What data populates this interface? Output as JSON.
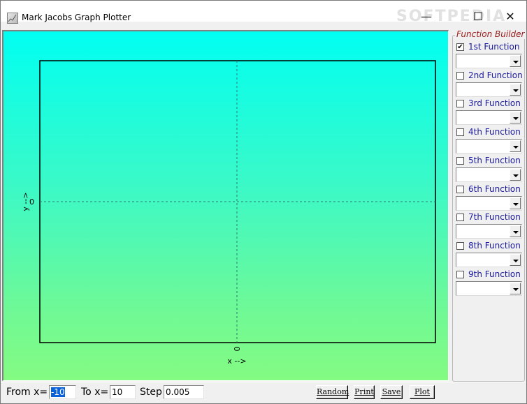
{
  "window": {
    "title": "Mark Jacobs Graph Plotter",
    "controls": {
      "minimize": "—",
      "maximize": "☐",
      "close": "✕"
    },
    "watermark": "SOFTPEDIA"
  },
  "plot": {
    "y_axis_label": "y -->",
    "x_axis_label": "x -->",
    "y_zero_label": "0",
    "x_zero_label": "0",
    "gradient_colors": [
      "#00fff2",
      "#84fb82"
    ]
  },
  "function_builder": {
    "title": "Function Builder",
    "functions": [
      {
        "label": "1st Function",
        "checked": true,
        "value": ""
      },
      {
        "label": "2nd Function",
        "checked": false,
        "value": ""
      },
      {
        "label": "3rd Function",
        "checked": false,
        "value": ""
      },
      {
        "label": "4th Function",
        "checked": false,
        "value": ""
      },
      {
        "label": "5th Function",
        "checked": false,
        "value": ""
      },
      {
        "label": "6th Function",
        "checked": false,
        "value": ""
      },
      {
        "label": "7th Function",
        "checked": false,
        "value": ""
      },
      {
        "label": "8th Function",
        "checked": false,
        "value": ""
      },
      {
        "label": "9th Function",
        "checked": false,
        "value": ""
      }
    ]
  },
  "range": {
    "from_label": "From x=",
    "from_value": "-10",
    "to_label": "To x=",
    "to_value": "10",
    "step_label": "Step",
    "step_value": "0.005"
  },
  "buttons": {
    "random": "Random",
    "print": "Print",
    "save": "Save",
    "plot": "Plot"
  }
}
